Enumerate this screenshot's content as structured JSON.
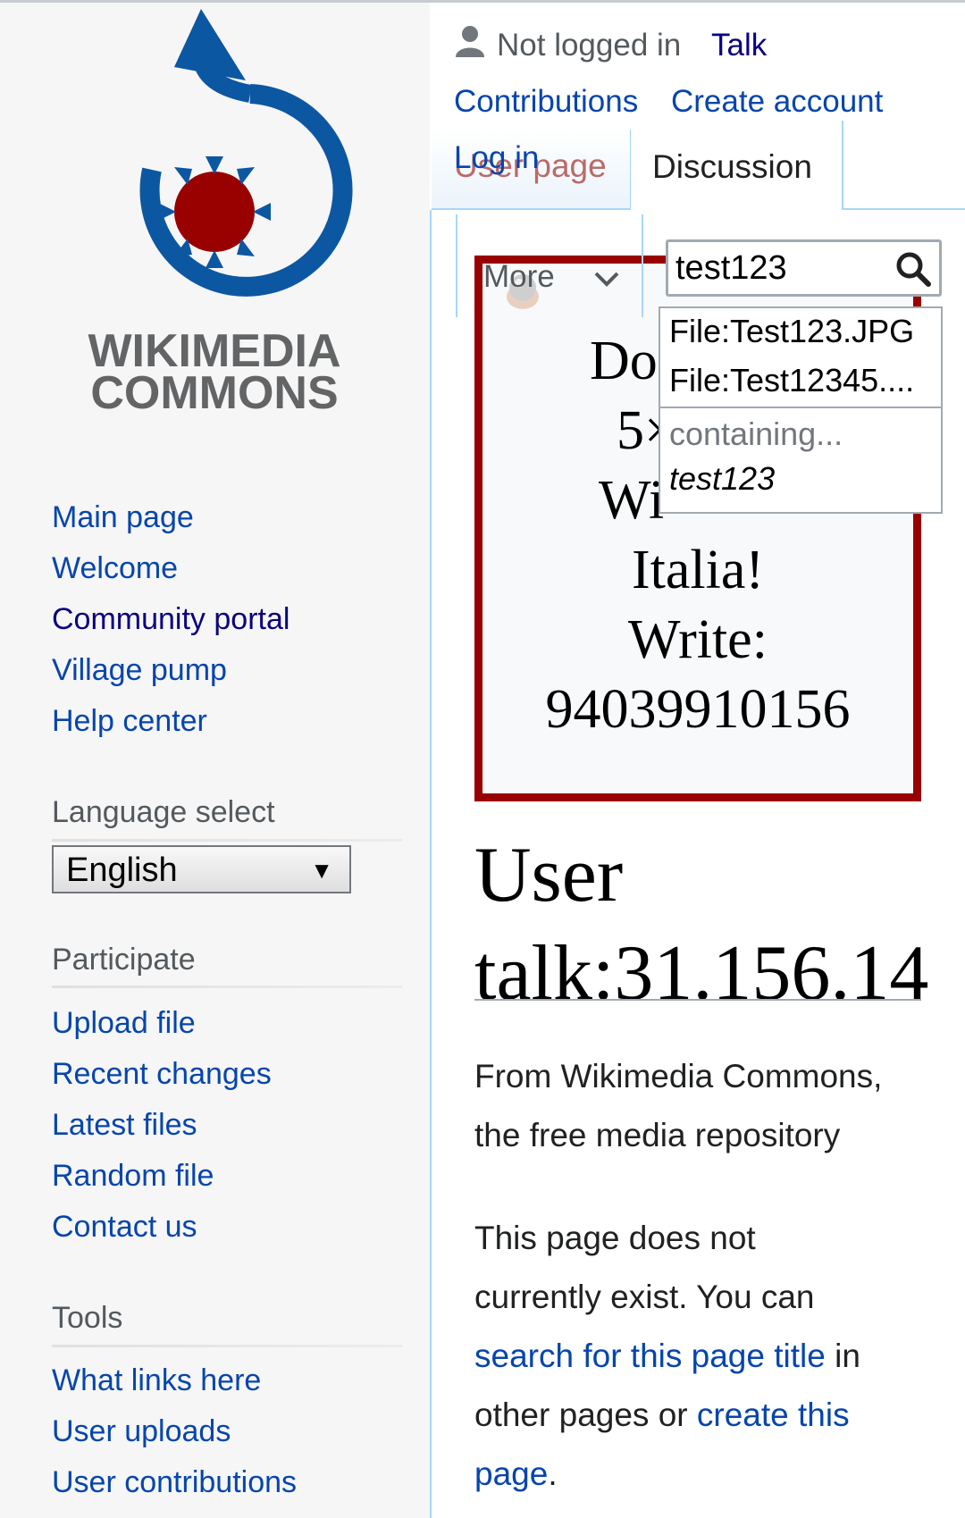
{
  "logo": {
    "line1": "WIKIMEDIA",
    "line2": "COMMONS"
  },
  "personal": {
    "not_logged_in": "Not logged in",
    "talk": "Talk",
    "contributions": "Contributions",
    "create_account": "Create account",
    "log_in": "Log in"
  },
  "tabs": {
    "user_page": "User page",
    "discussion": "Discussion",
    "more": "More"
  },
  "search": {
    "value": "test123",
    "suggestions": [
      "File:Test123.JPG",
      "File:Test12345...."
    ],
    "containing_label": "containing...",
    "containing_query": "test123"
  },
  "banner": {
    "lines": [
      "Dor",
      "5×",
      "Wi",
      "Italia!",
      "Write:",
      "94039910156"
    ]
  },
  "sidebar": {
    "navigation": [
      "Main page",
      "Welcome",
      "Community portal",
      "Village pump",
      "Help center"
    ],
    "language_heading": "Language select",
    "language_value": "English",
    "participate_heading": "Participate",
    "participate": [
      "Upload file",
      "Recent changes",
      "Latest files",
      "Random file",
      "Contact us"
    ],
    "tools_heading": "Tools",
    "tools": [
      "What links here",
      "User uploads",
      "User contributions"
    ]
  },
  "content": {
    "title_line1": "User",
    "title_line2": "talk:31.156.14",
    "tagline_line1": "From Wikimedia Commons,",
    "tagline_line2": "the free media repository",
    "notice_line1": "This page does not",
    "notice_line2": "currently exist. You can",
    "search_link": "search for this page title",
    "in_text": " in",
    "notice_line4_pre": "other pages or ",
    "create_link": "create this",
    "create_link2": "page",
    "period": "."
  },
  "colors": {
    "link": "#0645ad",
    "visited": "#0b0080",
    "banner_border": "#990000",
    "logo_blue": "#036",
    "logo_red": "#900"
  }
}
